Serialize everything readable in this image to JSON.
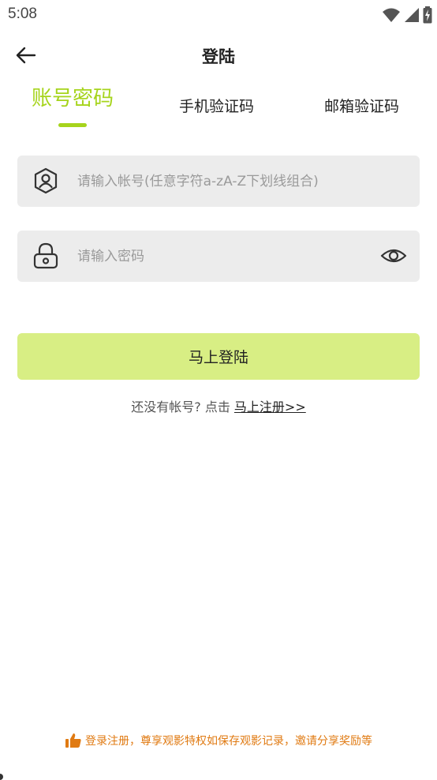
{
  "status_bar": {
    "time": "5:08",
    "icons": [
      "wifi-icon",
      "signal-icon",
      "battery-charging-icon"
    ]
  },
  "header": {
    "title": "登陆",
    "back_icon": "arrow-left-icon"
  },
  "tabs": [
    {
      "label": "账号密码",
      "active": true
    },
    {
      "label": "手机验证码",
      "active": false
    },
    {
      "label": "邮箱验证码",
      "active": false
    }
  ],
  "form": {
    "account": {
      "icon": "user-shield-icon",
      "value": "",
      "placeholder": "请输入帐号(任意字符a-zA-Z下划线组合)"
    },
    "password": {
      "icon": "lock-icon",
      "value": "",
      "placeholder": "请输入密码",
      "toggle_icon": "eye-icon"
    },
    "submit_label": "马上登陆"
  },
  "register": {
    "prompt": "还没有帐号? 点击",
    "link_label": "马上注册>>"
  },
  "footer": {
    "icon": "thumbs-up-icon",
    "note": "登录注册，尊享观影特权如保存观影记录，邀请分享奖励等"
  },
  "colors": {
    "accent": "#a6d41c",
    "button_bg": "#d8ee84",
    "field_bg": "#ececec",
    "note": "#e07a12"
  }
}
